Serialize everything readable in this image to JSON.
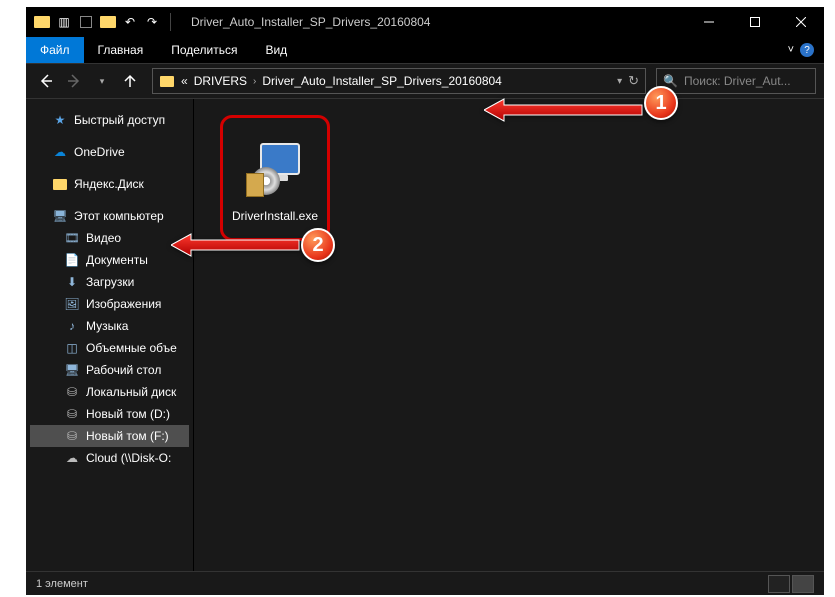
{
  "window": {
    "title": "Driver_Auto_Installer_SP_Drivers_20160804"
  },
  "ribbon": {
    "file": "Файл",
    "tabs": [
      "Главная",
      "Поделиться",
      "Вид"
    ]
  },
  "breadcrumb": {
    "prefix": "«",
    "items": [
      "DRIVERS",
      "Driver_Auto_Installer_SP_Drivers_20160804"
    ]
  },
  "search": {
    "placeholder": "Поиск: Driver_Aut..."
  },
  "nav": {
    "quick": "Быстрый доступ",
    "onedrive": "OneDrive",
    "ydisk": "Яндекс.Диск",
    "thispc": "Этот компьютер",
    "video": "Видео",
    "documents": "Документы",
    "downloads": "Загрузки",
    "images": "Изображения",
    "music": "Музыка",
    "volumes": "Объемные объе",
    "desktop": "Рабочий стол",
    "localdisk": "Локальный диск",
    "newvol_d": "Новый том (D:)",
    "newvol_f": "Новый том (F:)",
    "cloud": "Cloud (\\\\Disk-O:"
  },
  "file": {
    "name": "DriverInstall.exe"
  },
  "status": {
    "count": "1 элемент"
  },
  "annotations": {
    "b1": "1",
    "b2": "2"
  }
}
